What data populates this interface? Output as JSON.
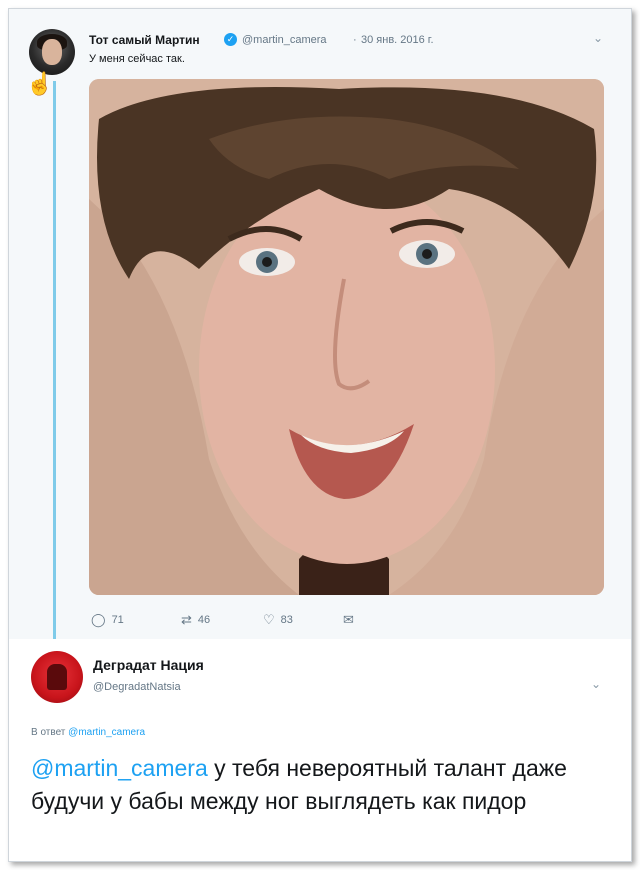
{
  "tweet": {
    "author_name": "Тот самый Мартин",
    "handle": "@martin_camera",
    "separator": "·",
    "date": "30 янв. 2016 г.",
    "text": "У меня сейчас так.",
    "photo_icon": "selfie-photo",
    "actions": {
      "replies": "71",
      "retweets": "46",
      "likes": "83"
    }
  },
  "reply": {
    "author_name": "Деградат Нация",
    "handle": "@DegradatNatsia",
    "reply_prefix": "В ответ",
    "reply_handle": "@martin_camera",
    "mention": "@martin_camera",
    "text": " у тебя невероятный талант даже будучи у бабы между ног выглядеть как пидор"
  },
  "colors": {
    "accent": "#1da1f2",
    "thread_line": "#7fcbe9",
    "muted": "#657786",
    "tweet_bg": "#f5f8fa"
  }
}
